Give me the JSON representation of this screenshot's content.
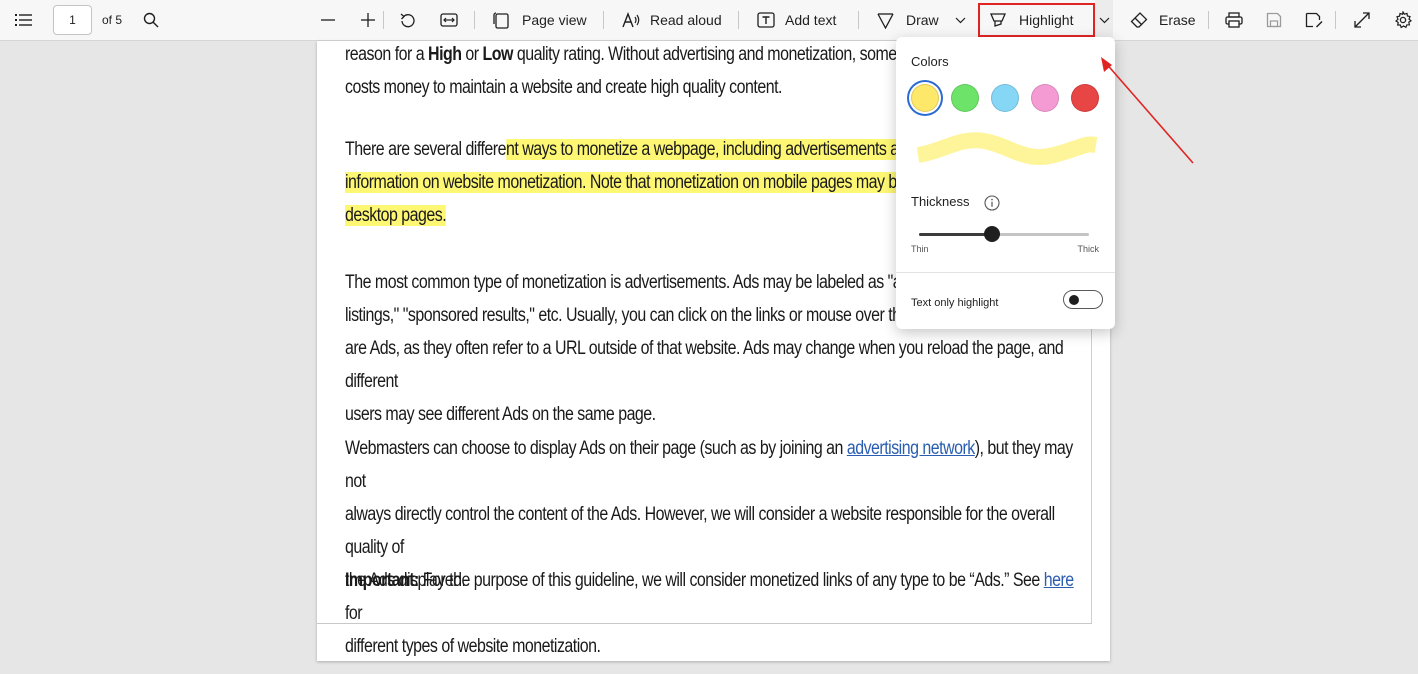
{
  "toolbar": {
    "page_current": "1",
    "page_total": "of 5",
    "page_view_label": "Page view",
    "read_aloud_label": "Read aloud",
    "add_text_label": "Add text",
    "draw_label": "Draw",
    "highlight_label": "Highlight",
    "erase_label": "Erase"
  },
  "document": {
    "p1": {
      "line1_a": "reason for a ",
      "line1_high": "High",
      "line1_or": " or ",
      "line1_low": "Low",
      "line1_b": " quality rating.  Without advertising and monetization, some webpag",
      "line2": "costs money to maintain a website and create high quality content."
    },
    "p2": {
      "line1_plain": "There are several differe",
      "line1_hl": "nt ways to monetize a webpage, including advertisements and progra",
      "line2_hl": "information on website monetization.  Note that monetization on mobile pages may be more s",
      "line3_hl": "desktop pages."
    },
    "p3": {
      "line1": "The most common type of monetization is advertisements.  Ads may be labeled as \"ads,\" \"sp",
      "line2": "listings,\" \"sponsored results,\" etc.  Usually, you can click on the links or mouse over the conte",
      "line3": "are Ads, as they often refer to a URL outside of that website.  Ads may change when you reload the page, and different",
      "line4": "users may see different Ads on the same page."
    },
    "p4": {
      "line1_a": "Webmasters can choose to display Ads on their page (such as by joining an ",
      "line1_link": "advertising network",
      "line1_b": "), but they may not",
      "line2": "always directly control the content of the Ads.  However, we will consider a website responsible for the overall quality of",
      "line3": "the Ads displayed."
    },
    "p5": {
      "line1_bold": "Important:",
      "line1_a": " For the purpose of this guideline, we will consider monetized links of any type to be “Ads.”  See ",
      "line1_link": "here",
      "line1_b": " for",
      "line2": "different types of website monetization."
    }
  },
  "highlight_panel": {
    "colors_title": "Colors",
    "colors": [
      "#fde86a",
      "#6ee36a",
      "#86d6f6",
      "#f59bd4",
      "#e84545"
    ],
    "selected_color_index": 0,
    "preview_color": "#fef59a",
    "thickness_title": "Thickness",
    "thin_label": "Thin",
    "thick_label": "Thick",
    "thickness_level": 0.43,
    "text_only_label": "Text only highlight",
    "text_only_enabled": false
  },
  "annotation": {
    "color": "#e02424"
  }
}
